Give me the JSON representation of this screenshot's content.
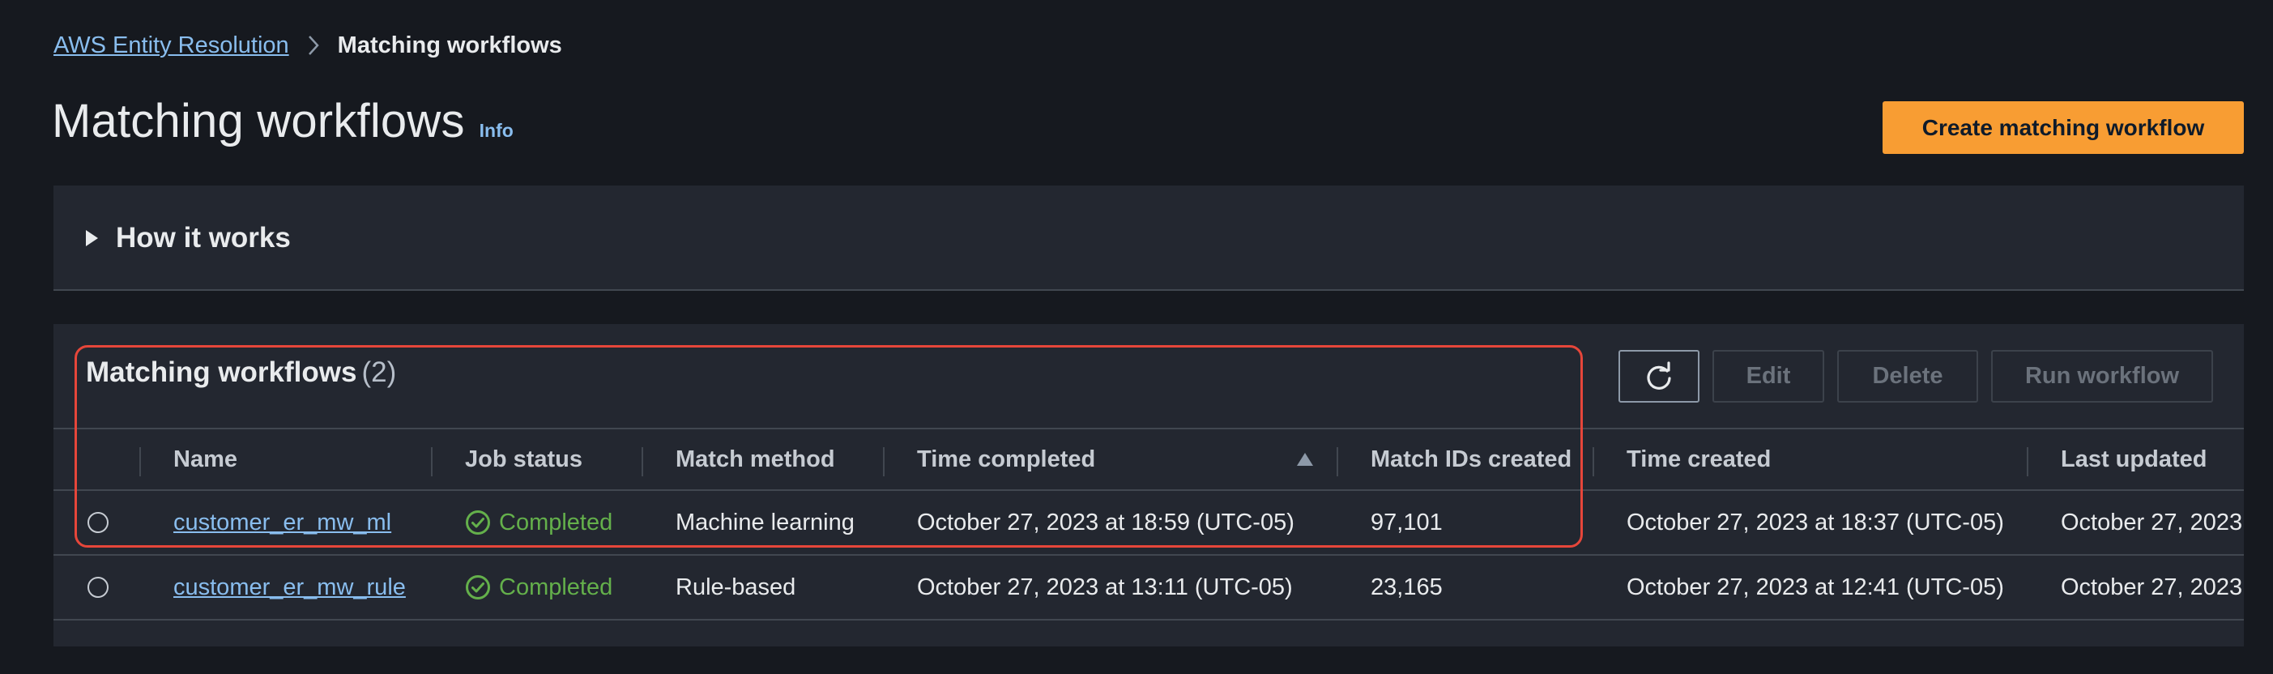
{
  "breadcrumb": {
    "root": "AWS Entity Resolution",
    "current": "Matching workflows"
  },
  "header": {
    "title": "Matching workflows",
    "info": "Info",
    "create_button": "Create matching workflow"
  },
  "how_it_works": {
    "label": "How it works"
  },
  "table": {
    "title": "Matching workflows",
    "count": "(2)",
    "buttons": {
      "edit": "Edit",
      "delete": "Delete",
      "run": "Run workflow"
    },
    "columns": [
      "Name",
      "Job status",
      "Match method",
      "Time completed",
      "Match IDs created",
      "Time created",
      "Last updated"
    ],
    "rows": [
      {
        "name": "customer_er_mw_ml",
        "status": "Completed",
        "method": "Machine learning",
        "time_completed": "October 27, 2023 at 18:59 (UTC-05)",
        "match_ids": "97,101",
        "time_created": "October 27, 2023 at 18:37 (UTC-05)",
        "last_updated": "October 27, 2023"
      },
      {
        "name": "customer_er_mw_rule",
        "status": "Completed",
        "method": "Rule-based",
        "time_completed": "October 27, 2023 at 13:11 (UTC-05)",
        "match_ids": "23,165",
        "time_created": "October 27, 2023 at 12:41 (UTC-05)",
        "last_updated": "October 27, 2023"
      }
    ]
  },
  "colors": {
    "background": "#16191f",
    "panel": "#232730",
    "link": "#89bdee",
    "primary_button": "#f89d33",
    "success": "#64b04b",
    "highlight": "#e6463a"
  },
  "icons": [
    "chevron-right-icon",
    "caret-right-icon",
    "refresh-icon",
    "sort-ascending-icon",
    "check-circle-icon"
  ]
}
